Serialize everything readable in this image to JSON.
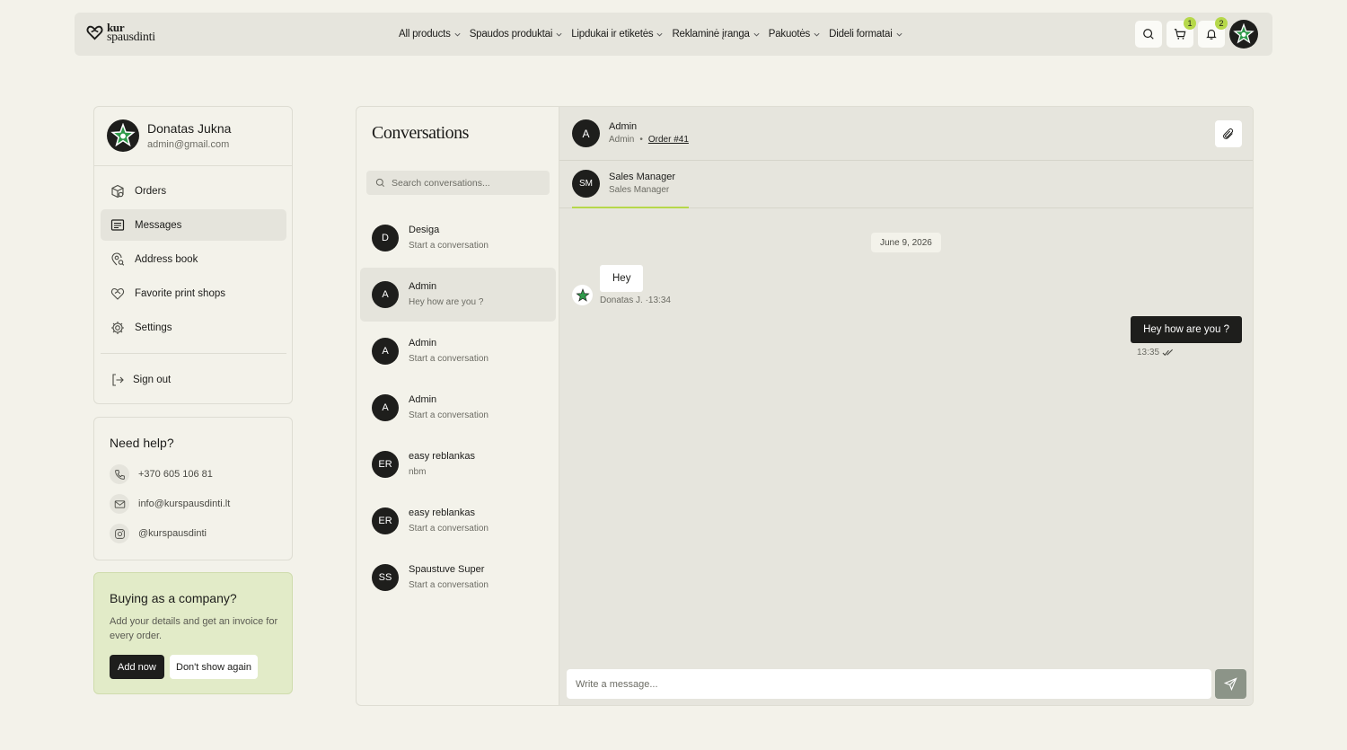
{
  "header": {
    "logo_line1": "kur",
    "logo_line2": "spausdinti",
    "nav": [
      "All products",
      "Spaudos produktai",
      "Lipdukai ir etiketės",
      "Reklaminė įranga",
      "Pakuotės",
      "Dideli formatai"
    ],
    "cart_count": "1",
    "notifications_count": "2"
  },
  "profile": {
    "name": "Donatas Jukna",
    "email": "admin@gmail.com",
    "menu": {
      "orders": "Orders",
      "messages": "Messages",
      "address_book": "Address book",
      "favorites": "Favorite print shops",
      "settings": "Settings",
      "sign_out": "Sign out"
    }
  },
  "help": {
    "title": "Need help?",
    "phone": "+370 605 106 81",
    "email": "info@kurspausdinti.lt",
    "instagram": "@kurspausdinti"
  },
  "company": {
    "title": "Buying as a company?",
    "text": "Add your details and get an invoice for every order.",
    "add_label": "Add now",
    "dismiss_label": "Don't show again"
  },
  "conversations": {
    "title": "Conversations",
    "search_placeholder": "Search conversations...",
    "items": [
      {
        "initials": "D",
        "name": "Desiga",
        "preview": "Start a conversation"
      },
      {
        "initials": "A",
        "name": "Admin",
        "preview": "Hey how are you ?"
      },
      {
        "initials": "A",
        "name": "Admin",
        "preview": "Start a conversation"
      },
      {
        "initials": "A",
        "name": "Admin",
        "preview": "Start a conversation"
      },
      {
        "initials": "ER",
        "name": "easy reblankas",
        "preview": "nbm"
      },
      {
        "initials": "ER",
        "name": "easy reblankas",
        "preview": "Start a conversation"
      },
      {
        "initials": "SS",
        "name": "Spaustuve Super",
        "preview": "Start a conversation"
      }
    ]
  },
  "chat": {
    "contact_initials": "A",
    "contact_name": "Admin",
    "contact_role": "Admin",
    "separator": "•",
    "order_link": "Order #41",
    "participant": {
      "initials": "SM",
      "name": "Sales Manager",
      "role": "Sales Manager"
    },
    "date": "June 9, 2026",
    "messages": [
      {
        "text": "Hey",
        "meta": "Donatas J. ·13:34"
      },
      {
        "text": "Hey how are you ?",
        "meta": "13:35"
      }
    ],
    "compose_placeholder": "Write a message..."
  },
  "colors": {
    "accent": "#b6d84a",
    "dark": "#1e1e1c",
    "company_card": "#e2ebc8"
  }
}
